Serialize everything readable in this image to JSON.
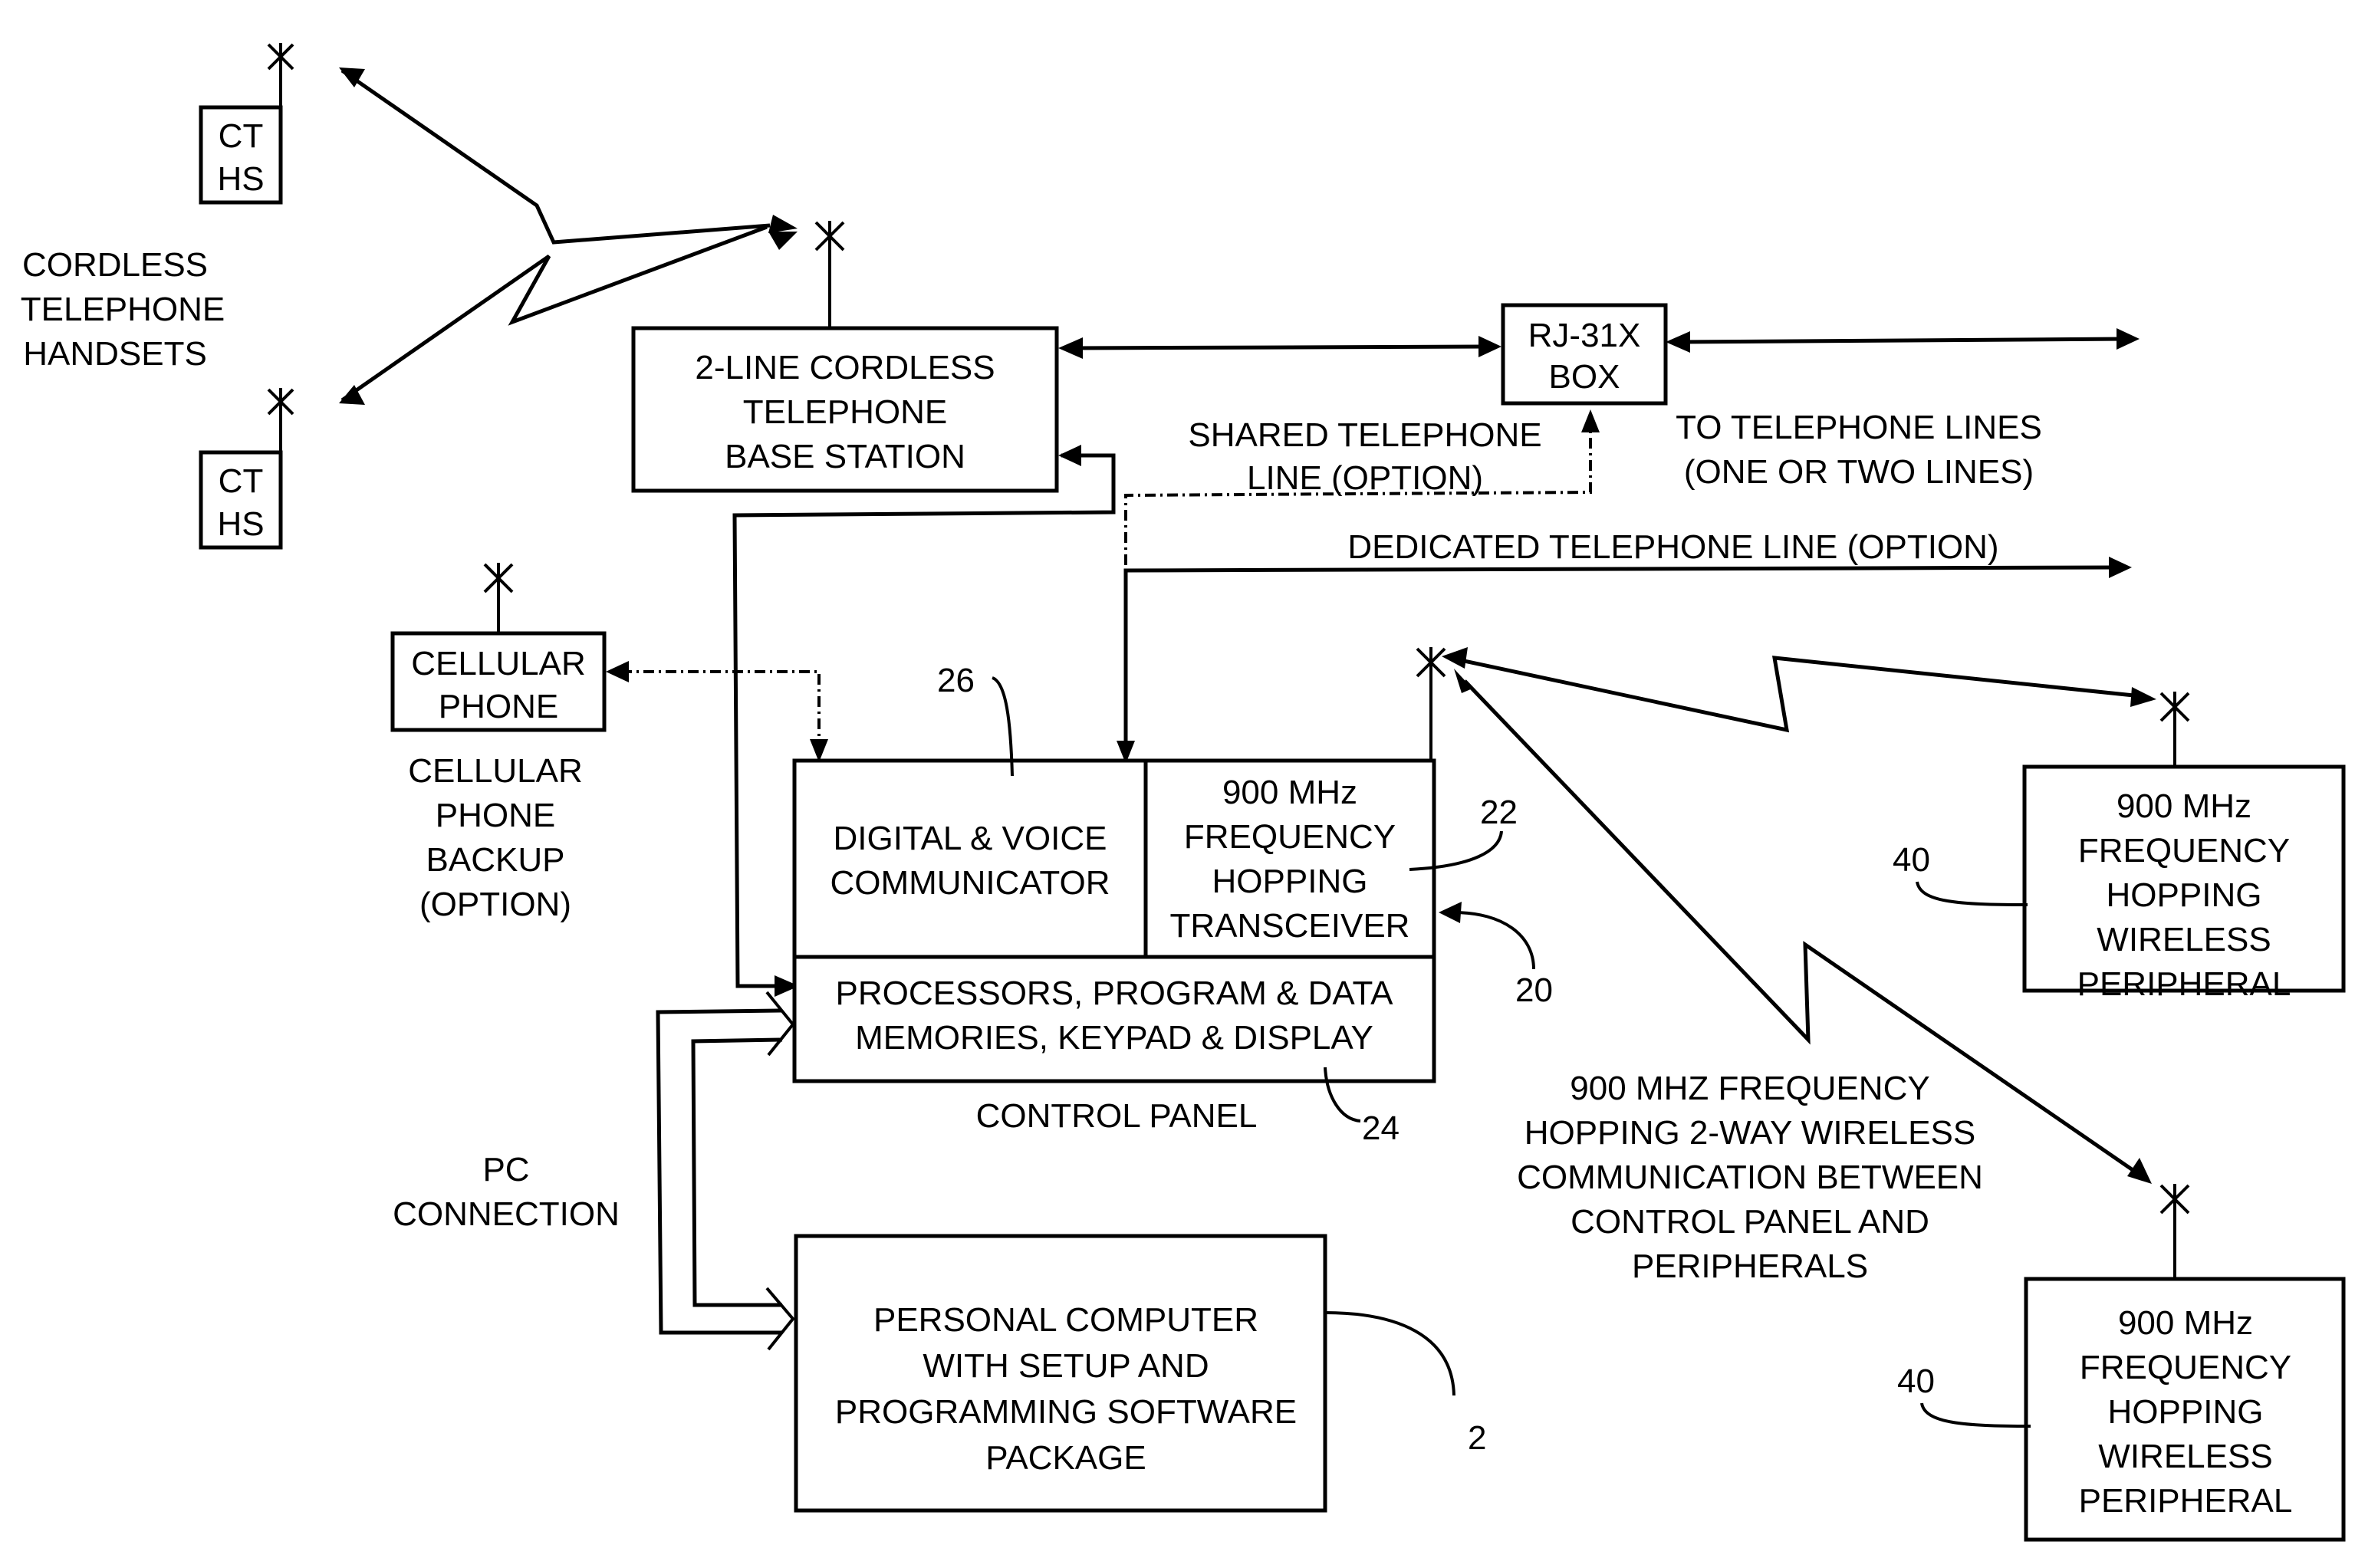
{
  "diagram": {
    "handsets": {
      "label_lines": [
        "CORDLESS",
        "TELEPHONE",
        "HANDSETS"
      ],
      "units": [
        {
          "lines": [
            "CT",
            "HS"
          ]
        },
        {
          "lines": [
            "CT",
            "HS"
          ]
        }
      ]
    },
    "base_station": {
      "lines": [
        "2-LINE CORDLESS",
        "TELEPHONE",
        "BASE STATION"
      ]
    },
    "rj31x": {
      "lines": [
        "RJ-31X",
        "BOX"
      ]
    },
    "to_lines": {
      "lines": [
        "TO TELEPHONE LINES",
        "(ONE OR TWO LINES)"
      ]
    },
    "shared_line": {
      "lines": [
        "SHARED TELEPHONE",
        "LINE (OPTION)"
      ]
    },
    "dedicated_line": {
      "label": "DEDICATED TELEPHONE LINE (OPTION)"
    },
    "cellular": {
      "box_lines": [
        "CELLULAR",
        "PHONE"
      ],
      "caption_lines": [
        "CELLULAR",
        "PHONE",
        "BACKUP",
        "(OPTION)"
      ]
    },
    "communicator": {
      "lines": [
        "DIGITAL & VOICE",
        "COMMUNICATOR"
      ],
      "ref": "26"
    },
    "transceiver": {
      "lines": [
        "900 MHz",
        "FREQUENCY",
        "HOPPING",
        "TRANSCEIVER"
      ],
      "ref": "22"
    },
    "control_panel_ref": "20",
    "processors": {
      "lines": [
        "PROCESSORS, PROGRAM & DATA",
        "MEMORIES, KEYPAD & DISPLAY"
      ],
      "ref": "24"
    },
    "control_panel_label": "CONTROL PANEL",
    "pc_connection": {
      "lines": [
        "PC",
        "CONNECTION"
      ]
    },
    "pc": {
      "lines": [
        "PERSONAL COMPUTER",
        "WITH SETUP AND",
        "PROGRAMMING SOFTWARE",
        "PACKAGE"
      ],
      "ref": "2"
    },
    "wireless_caption": {
      "lines": [
        "900 MHZ FREQUENCY",
        "HOPPING 2-WAY WIRELESS",
        "COMMUNICATION BETWEEN",
        "CONTROL PANEL AND",
        "PERIPHERALS"
      ]
    },
    "peripherals": [
      {
        "lines": [
          "900 MHz",
          "FREQUENCY",
          "HOPPING",
          "WIRELESS",
          "PERIPHERAL"
        ],
        "ref": "40"
      },
      {
        "lines": [
          "900 MHz",
          "FREQUENCY",
          "HOPPING",
          "WIRELESS",
          "PERIPHERAL"
        ],
        "ref": "40"
      }
    ]
  }
}
